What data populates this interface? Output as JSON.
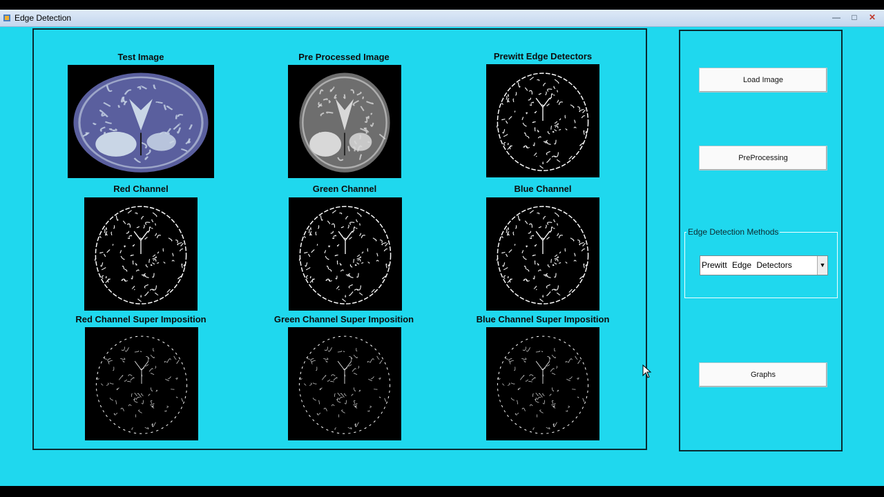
{
  "window": {
    "title": "Edge Detection",
    "minimize_glyph": "—",
    "maximize_glyph": "□",
    "close_glyph": "✕"
  },
  "images": [
    {
      "title": "Test Image",
      "kind": "mri-color"
    },
    {
      "title": "Pre Processed Image",
      "kind": "mri-gray"
    },
    {
      "title": "Prewitt Edge Detectors",
      "kind": "edges"
    },
    {
      "title": "Red Channel",
      "kind": "edges"
    },
    {
      "title": "Green Channel",
      "kind": "edges"
    },
    {
      "title": "Blue Channel",
      "kind": "edges"
    },
    {
      "title": "Red Channel Super Imposition",
      "kind": "edges-sparse"
    },
    {
      "title": "Green Channel Super Imposition",
      "kind": "edges-sparse"
    },
    {
      "title": "Blue Channel Super Imposition",
      "kind": "edges-sparse"
    }
  ],
  "controls": {
    "load_image": "Load  Image",
    "preprocessing": "PreProcessing",
    "methods_group": "Edge Detection Methods",
    "method_selected": "Prewitt  Edge  Detectors",
    "graphs": "Graphs"
  },
  "colors": {
    "background": "#1fd8ee",
    "image_bg": "#000000"
  }
}
